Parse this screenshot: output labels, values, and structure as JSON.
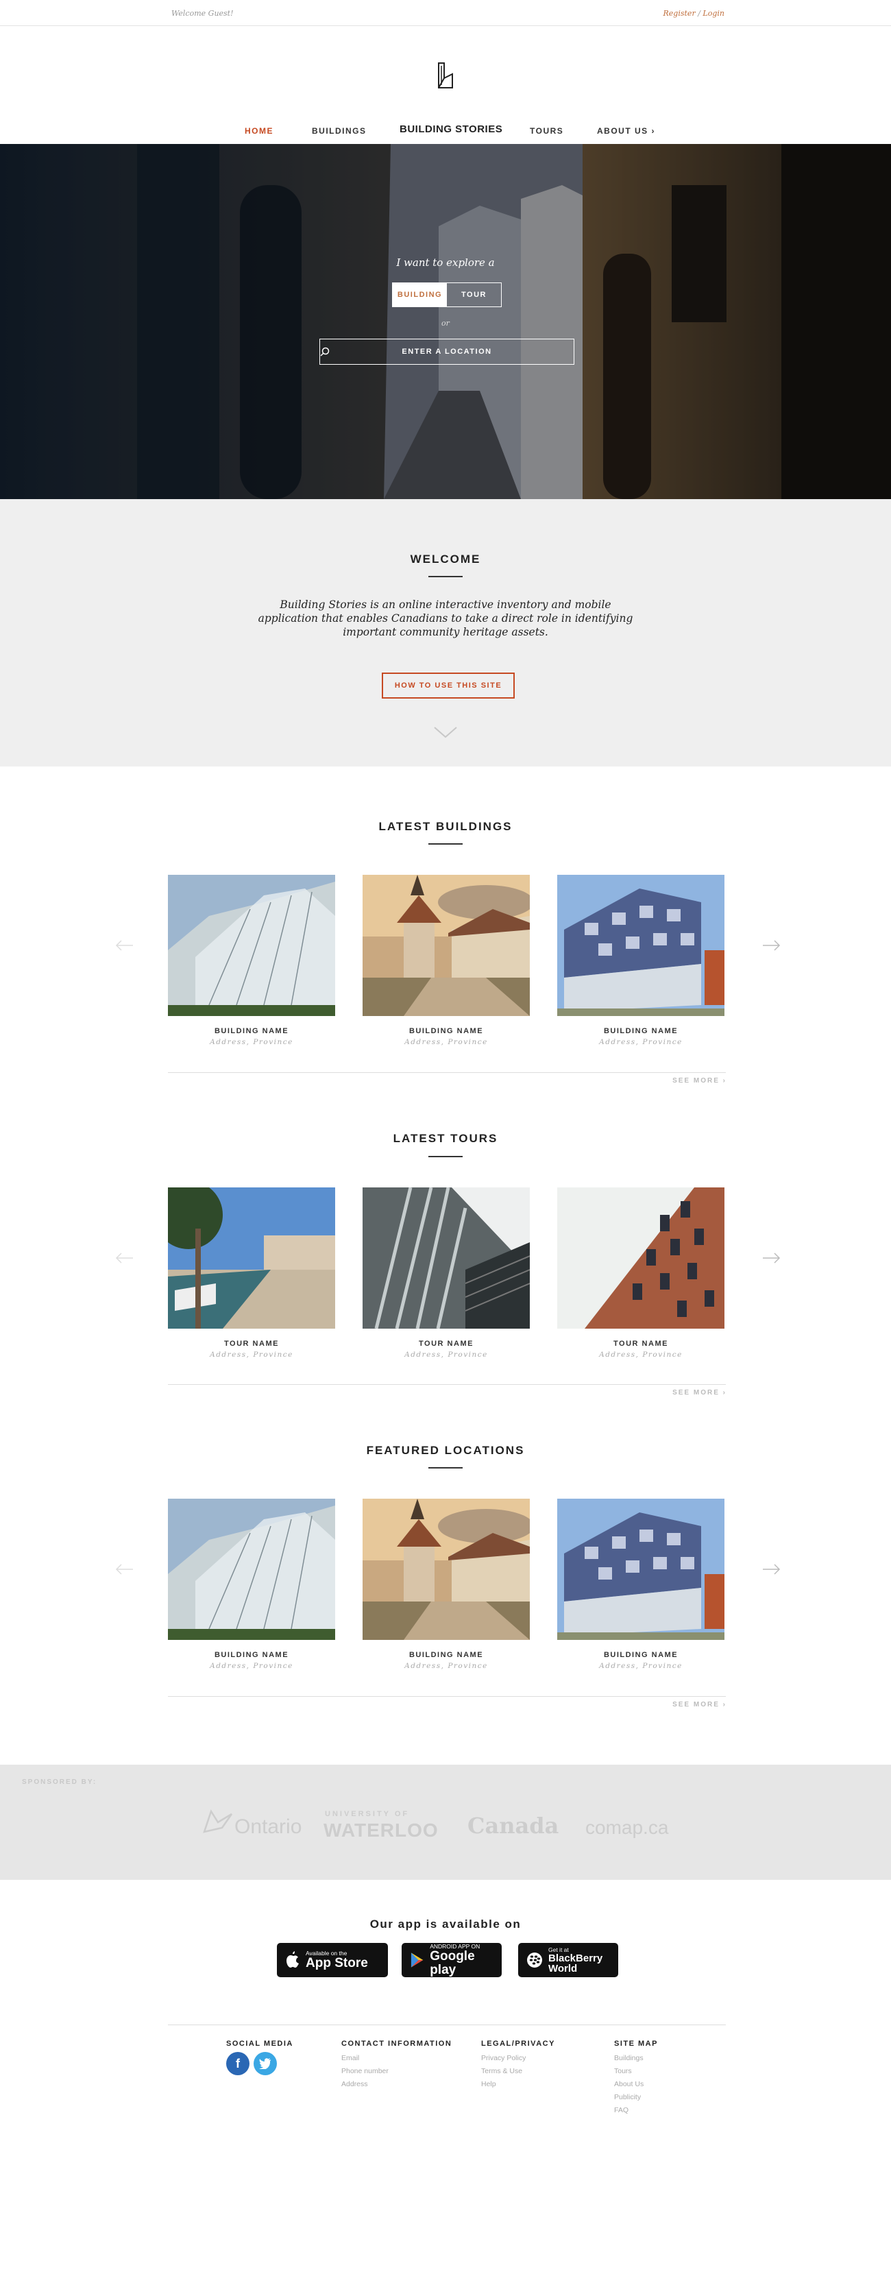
{
  "topbar": {
    "welcome": "Welcome Guest!",
    "register": "Register",
    "separator": "/",
    "login": "Login"
  },
  "nav": {
    "home": "HOME",
    "buildings": "BUILDINGS",
    "brand": "BUILDING STORIES",
    "tours": "TOURS",
    "about": "ABOUT US ›"
  },
  "hero": {
    "prompt": "I want to explore a",
    "toggle_building": "BUILDING",
    "toggle_tour": "TOUR",
    "or": "or",
    "location_placeholder": "ENTER A LOCATION"
  },
  "welcome": {
    "title": "WELCOME",
    "text": "Building Stories is an online interactive inventory and mobile application that enables Canadians to take a direct role in identifying important community heritage assets.",
    "button": "HOW TO USE THIS SITE"
  },
  "latest_buildings": {
    "title": "LATEST BUILDINGS",
    "items": [
      {
        "name": "BUILDING NAME",
        "address": "Address, Province"
      },
      {
        "name": "BUILDING NAME",
        "address": "Address, Province"
      },
      {
        "name": "BUILDING NAME",
        "address": "Address, Province"
      }
    ],
    "see_more": "SEE MORE ›"
  },
  "latest_tours": {
    "title": "LATEST TOURS",
    "items": [
      {
        "name": "TOUR NAME",
        "address": "Address, Province"
      },
      {
        "name": "TOUR NAME",
        "address": "Address, Province"
      },
      {
        "name": "TOUR NAME",
        "address": "Address, Province"
      }
    ],
    "see_more": "SEE MORE ›"
  },
  "featured_locations": {
    "title": "FEATURED LOCATIONS",
    "items": [
      {
        "name": "BUILDING NAME",
        "address": "Address, Province"
      },
      {
        "name": "BUILDING NAME",
        "address": "Address, Province"
      },
      {
        "name": "BUILDING NAME",
        "address": "Address, Province"
      }
    ],
    "see_more": "SEE MORE ›"
  },
  "sponsors": {
    "label": "SPONSORED BY:",
    "ontario": "Ontario",
    "waterloo_top": "UNIVERSITY OF",
    "waterloo": "WATERLOO",
    "canada": "Canada",
    "comap": "comap.ca"
  },
  "app": {
    "title": "Our app is available on",
    "appstore_small": "Available on the",
    "appstore_big": "App Store",
    "google_small": "ANDROID APP ON",
    "google_big": "Google play",
    "bb_small": "Get it at",
    "bb_big1": "BlackBerry",
    "bb_big2": "World"
  },
  "footer": {
    "social_head": "SOCIAL MEDIA",
    "contact_head": "CONTACT INFORMATION",
    "contact_items": [
      "Email",
      "Phone number",
      "Address"
    ],
    "legal_head": "LEGAL/PRIVACY",
    "legal_items": [
      "Privacy Policy",
      "Terms & Use",
      "Help"
    ],
    "sitemap_head": "SITE MAP",
    "sitemap_items": [
      "Buildings",
      "Tours",
      "About Us",
      "Publicity",
      "FAQ"
    ]
  },
  "colors": {
    "accent": "#c64a22",
    "link": "#c0703f",
    "facebook": "#2a67b4",
    "twitter": "#3aa7e4"
  }
}
